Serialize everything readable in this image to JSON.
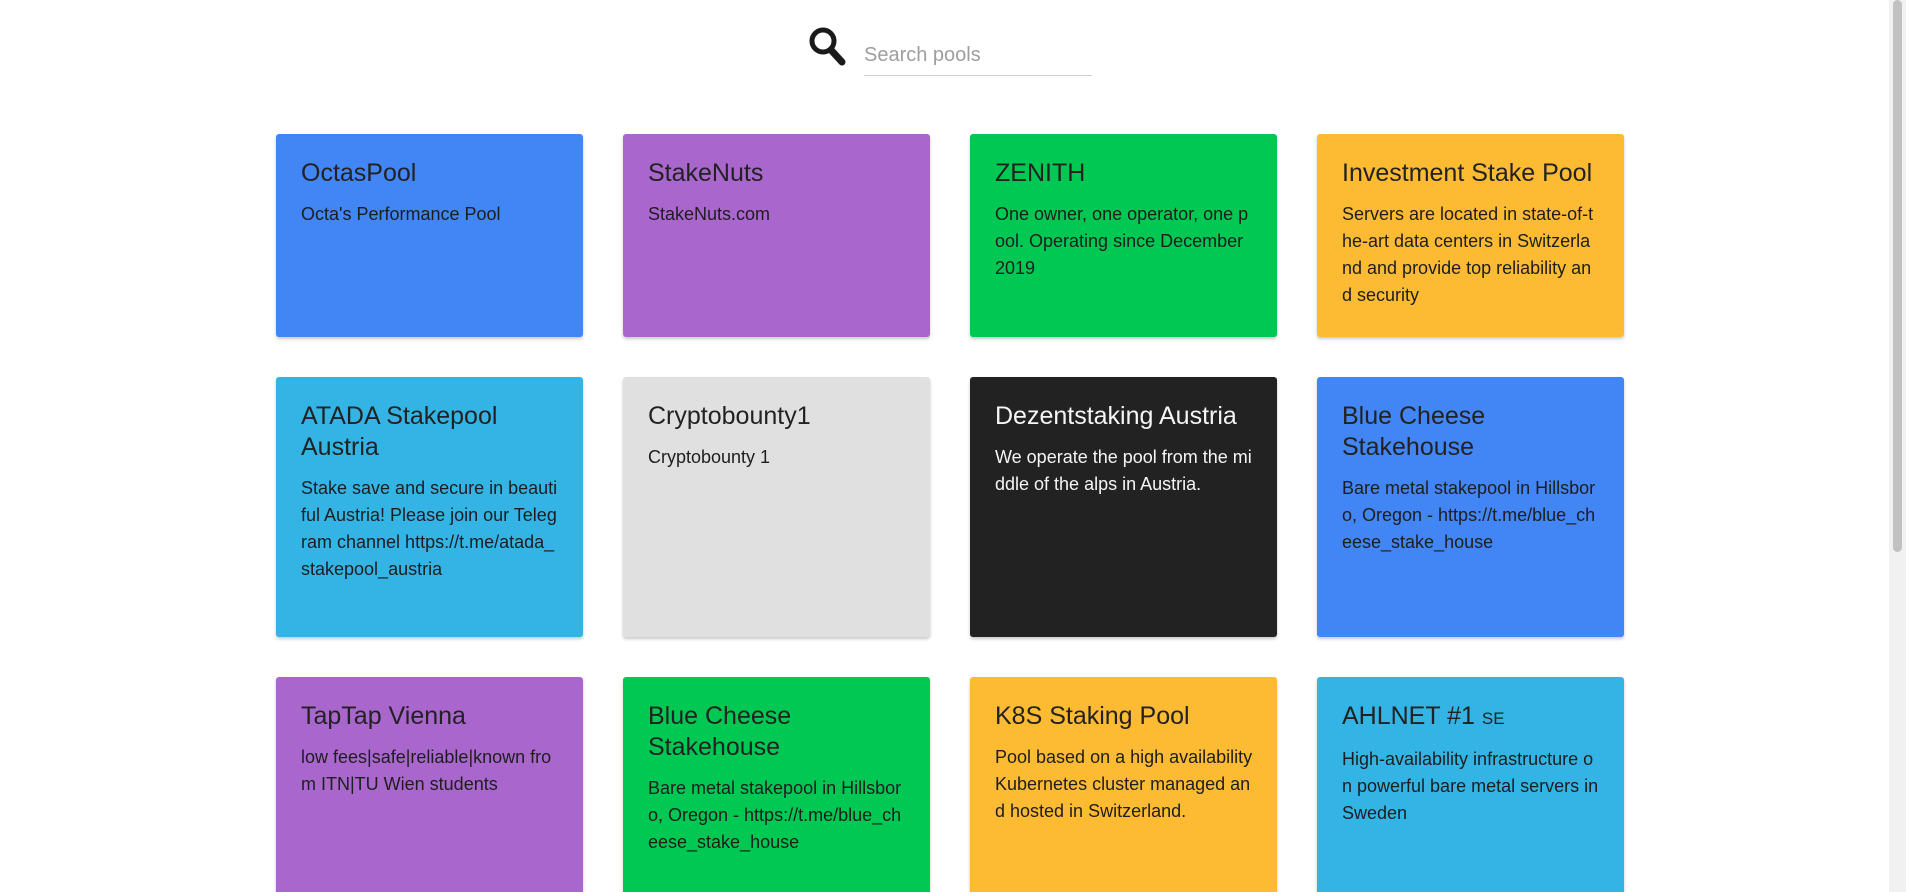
{
  "search": {
    "placeholder": "Search pools",
    "icon": "search-icon"
  },
  "colors": {
    "blue": "#4285f4",
    "purple": "#a966cd",
    "green": "#00c853",
    "amber": "#fcbb33",
    "cyan": "#33b4e5",
    "gray": "#e0e0e0",
    "dark": "#222222"
  },
  "pools": [
    {
      "title": "OctasPool",
      "suffix": "",
      "description": "Octa's Performance Pool",
      "color": "blue"
    },
    {
      "title": "StakeNuts",
      "suffix": "",
      "description": "StakeNuts.com",
      "color": "purple"
    },
    {
      "title": "ZENITH",
      "suffix": "",
      "description": "One owner, one operator, one pool. Operating since December 2019",
      "color": "green"
    },
    {
      "title": "Investment Stake Pool",
      "suffix": "",
      "description": "Servers are located in state-of-the-art data centers in Switzerland and provide top reliability and security",
      "color": "amber"
    },
    {
      "title": "ATADA Stakepool Austria",
      "suffix": "",
      "description": "Stake save and secure in beautiful Austria! Please join our Telegram channel https://t.me/atada_stakepool_austria",
      "color": "cyan"
    },
    {
      "title": "Cryptobounty1",
      "suffix": "",
      "description": "Cryptobounty 1",
      "color": "gray"
    },
    {
      "title": "Dezentstaking Austria",
      "suffix": "",
      "description": "We operate the pool from the middle of the alps in Austria.",
      "color": "dark"
    },
    {
      "title": "Blue Cheese Stakehouse",
      "suffix": "",
      "description": "Bare metal stakepool in Hillsboro, Oregon - https://t.me/blue_cheese_stake_house",
      "color": "blue"
    },
    {
      "title": "TapTap Vienna",
      "suffix": "",
      "description": "low fees|safe|reliable|known from ITN|TU Wien students",
      "color": "purple"
    },
    {
      "title": "Blue Cheese Stakehouse",
      "suffix": "",
      "description": "Bare metal stakepool in Hillsboro, Oregon - https://t.me/blue_cheese_stake_house",
      "color": "green"
    },
    {
      "title": "K8S Staking Pool",
      "suffix": "",
      "description": "Pool based on a high availability Kubernetes cluster managed and hosted in Switzerland.",
      "color": "amber"
    },
    {
      "title": "AHLNET #1",
      "suffix": "SE",
      "description": "High-availability infrastructure on powerful bare metal servers in Sweden",
      "color": "cyan"
    }
  ]
}
